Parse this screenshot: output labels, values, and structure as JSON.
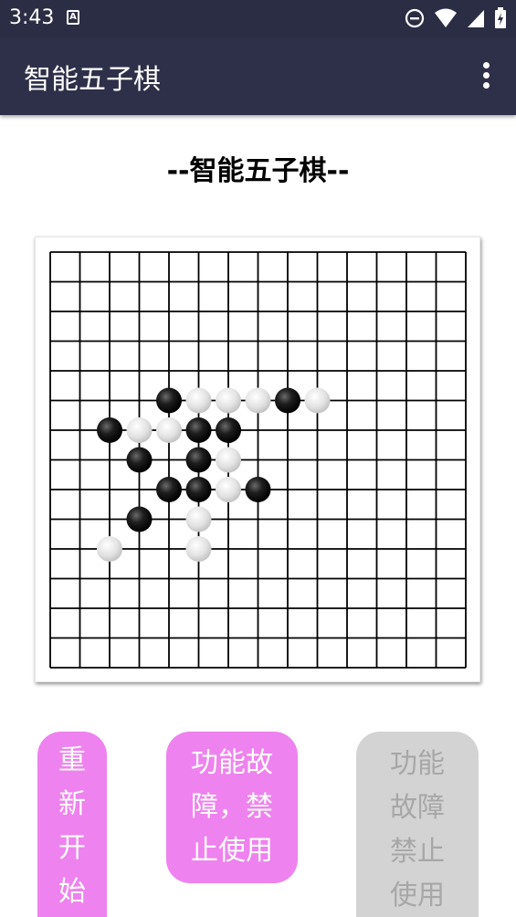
{
  "status_bar": {
    "time": "3:43",
    "notification_icon": "a-icon",
    "icons": [
      "do-not-disturb-icon",
      "wifi-icon",
      "signal-icon",
      "battery-icon"
    ]
  },
  "app_bar": {
    "title": "智能五子棋",
    "menu_icon": "more-vert-icon"
  },
  "heading": "--智能五子棋--",
  "board": {
    "size": 15,
    "stones": [
      {
        "col": 4,
        "row": 5,
        "color": "black"
      },
      {
        "col": 5,
        "row": 5,
        "color": "white"
      },
      {
        "col": 6,
        "row": 5,
        "color": "white"
      },
      {
        "col": 7,
        "row": 5,
        "color": "white"
      },
      {
        "col": 8,
        "row": 5,
        "color": "black"
      },
      {
        "col": 9,
        "row": 5,
        "color": "white"
      },
      {
        "col": 2,
        "row": 6,
        "color": "black"
      },
      {
        "col": 3,
        "row": 6,
        "color": "white"
      },
      {
        "col": 4,
        "row": 6,
        "color": "white"
      },
      {
        "col": 5,
        "row": 6,
        "color": "black"
      },
      {
        "col": 6,
        "row": 6,
        "color": "black"
      },
      {
        "col": 3,
        "row": 7,
        "color": "black"
      },
      {
        "col": 5,
        "row": 7,
        "color": "black"
      },
      {
        "col": 6,
        "row": 7,
        "color": "white"
      },
      {
        "col": 4,
        "row": 8,
        "color": "black"
      },
      {
        "col": 5,
        "row": 8,
        "color": "black"
      },
      {
        "col": 6,
        "row": 8,
        "color": "white"
      },
      {
        "col": 7,
        "row": 8,
        "color": "black"
      },
      {
        "col": 3,
        "row": 9,
        "color": "black"
      },
      {
        "col": 5,
        "row": 9,
        "color": "white"
      },
      {
        "col": 2,
        "row": 10,
        "color": "white"
      },
      {
        "col": 5,
        "row": 10,
        "color": "white"
      }
    ]
  },
  "buttons": {
    "restart": "重\n新\n开\n始",
    "middle": "功能故\n障，禁\n止使用",
    "right": "功能\n故障\n禁止\n使用"
  },
  "colors": {
    "status_bar_bg": "#2b2d45",
    "app_bar_bg": "#2e2f48",
    "button_active": "#ee82ee",
    "button_disabled": "#d3d3d3",
    "button_disabled_text": "#a7a7a7"
  }
}
